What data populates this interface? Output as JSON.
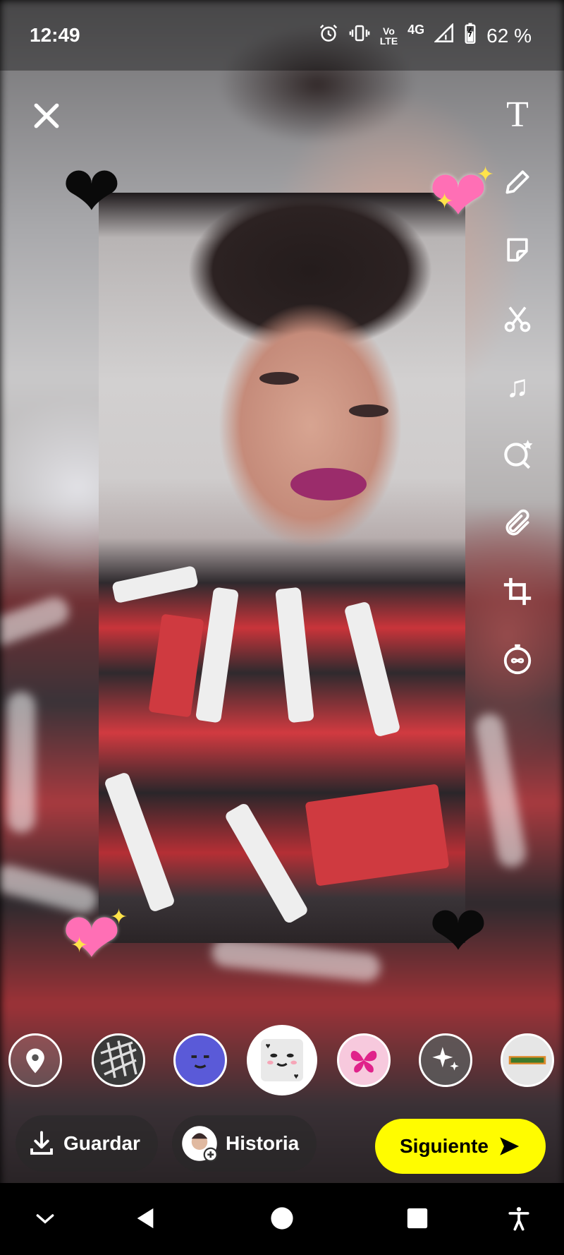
{
  "status_bar": {
    "time": "12:49",
    "volte_line1": "Vo",
    "volte_line2": "LTE",
    "network": "4G",
    "battery": "62 %",
    "icons": [
      "alarm-icon",
      "vibrate-icon",
      "volte-icon",
      "signal-icon",
      "battery-icon"
    ]
  },
  "editor": {
    "close_icon": "close-icon",
    "tools": [
      {
        "name": "text",
        "icon": "text-icon",
        "glyph": "T"
      },
      {
        "name": "draw",
        "icon": "pencil-icon"
      },
      {
        "name": "sticker",
        "icon": "sticker-icon"
      },
      {
        "name": "scissors",
        "icon": "scissors-icon"
      },
      {
        "name": "music",
        "icon": "music-note-icon",
        "glyph": "♫"
      },
      {
        "name": "lens",
        "icon": "lens-search-icon"
      },
      {
        "name": "attach",
        "icon": "paperclip-icon"
      },
      {
        "name": "crop",
        "icon": "crop-icon"
      },
      {
        "name": "timer",
        "icon": "timer-icon"
      }
    ],
    "stickers": [
      "black-heart",
      "pink-sparkling-heart",
      "pink-sparkling-heart",
      "black-heart"
    ]
  },
  "lens_carousel": [
    {
      "name": "location",
      "icon": "location-pin-icon"
    },
    {
      "name": "grid-filter",
      "icon": "grid-icon"
    },
    {
      "name": "face-filter-blue",
      "icon": "face-icon"
    },
    {
      "name": "cute-face-filter",
      "icon": "cute-face-icon",
      "selected": true
    },
    {
      "name": "butterfly-filter",
      "icon": "butterfly-icon"
    },
    {
      "name": "sparkles",
      "icon": "sparkles-icon"
    },
    {
      "name": "banner-filter",
      "icon": "banner-icon"
    }
  ],
  "actions": {
    "save_label": "Guardar",
    "story_label": "Historia",
    "next_label": "Siguiente"
  },
  "nav": [
    "chevron-down-icon",
    "back-icon",
    "home-icon",
    "recents-icon",
    "accessibility-icon"
  ],
  "colors": {
    "accent": "#fffc00",
    "heart_pink": "#ff6fb5",
    "heart_black": "#0a0a0a"
  }
}
